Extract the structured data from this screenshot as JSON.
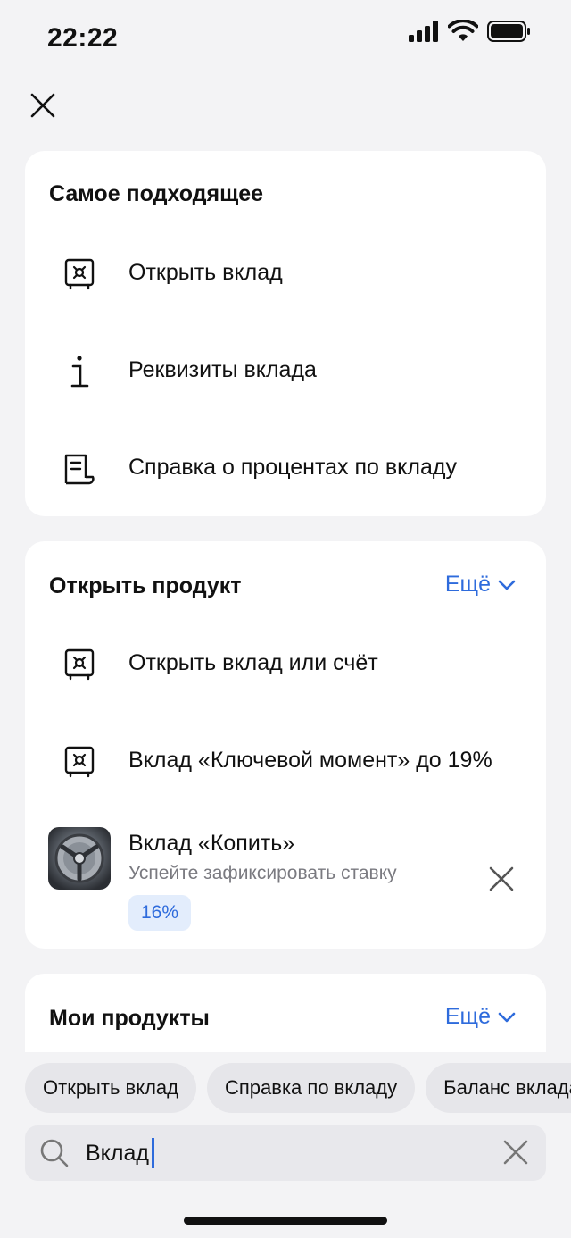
{
  "status": {
    "time": "22:22"
  },
  "section_best": {
    "title": "Самое подходящее",
    "items": [
      {
        "label": "Открыть вклад",
        "icon": "safe-icon"
      },
      {
        "label": "Реквизиты вклада",
        "icon": "info-icon"
      },
      {
        "label": "Справка о процентах по вкладу",
        "icon": "document-icon"
      }
    ]
  },
  "section_open": {
    "title": "Открыть продукт",
    "more_label": "Ещё",
    "items": [
      {
        "label": "Открыть вклад или счёт",
        "icon": "safe-icon"
      },
      {
        "label": "Вклад «Ключевой момент» до 19%",
        "icon": "safe-icon"
      }
    ],
    "promo": {
      "title": "Вклад «Копить»",
      "subtitle": "Успейте зафиксировать ставку",
      "badge": "16%"
    }
  },
  "section_my": {
    "title": "Мои продукты",
    "more_label": "Ещё"
  },
  "chips": [
    "Открыть вклад",
    "Справка по вкладу",
    "Баланс вклада"
  ],
  "search": {
    "value": "Вклад"
  },
  "colors": {
    "accent": "#2e6bdc",
    "background": "#f3f3f5",
    "card": "#ffffff"
  }
}
